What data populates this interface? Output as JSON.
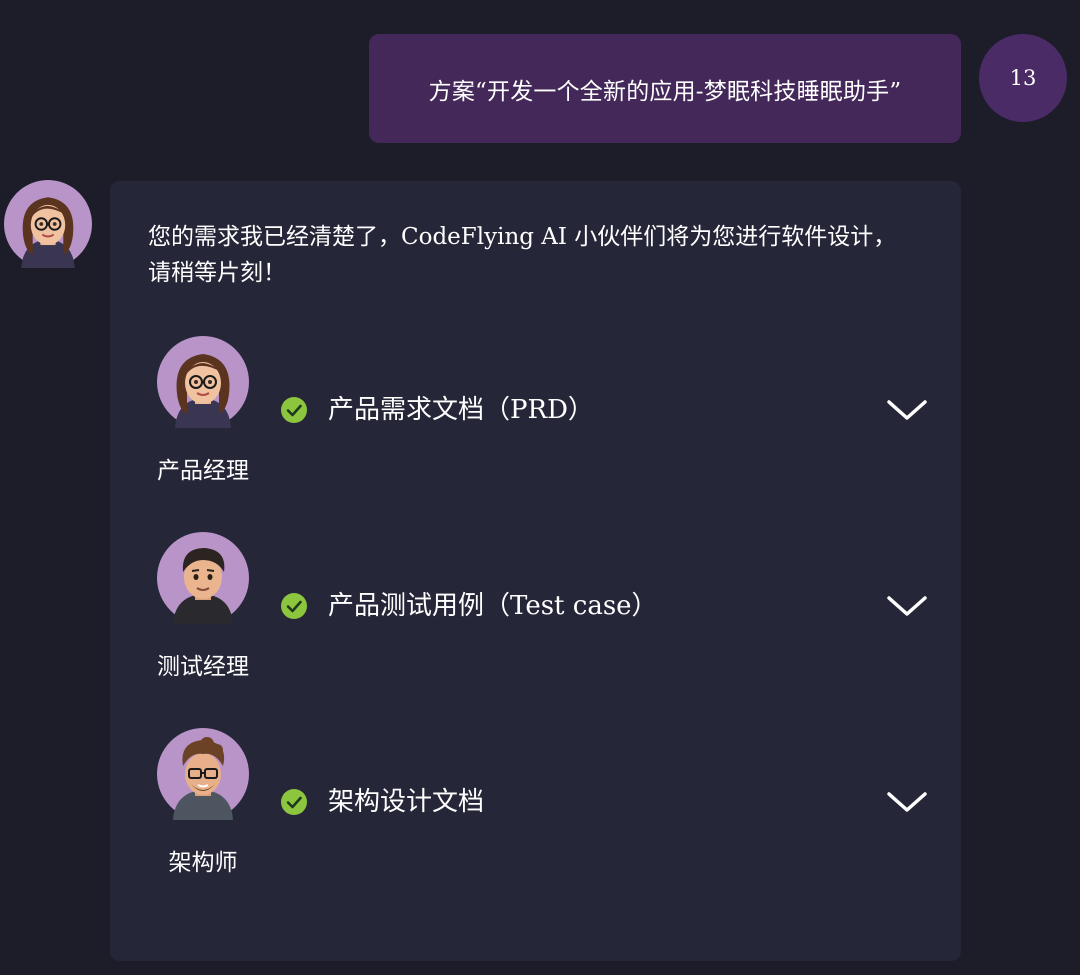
{
  "user_message": {
    "text": "方案“开发一个全新的应用-梦眠科技睡眠助手”",
    "avatar_label": "13"
  },
  "bot_message": {
    "intro": "您的需求我已经清楚了，CodeFlying AI 小伙伴们将为您进行软件设计，请稍等片刻！",
    "tasks": [
      {
        "role": "产品经理",
        "title": "产品需求文档（PRD）",
        "status": "complete"
      },
      {
        "role": "测试经理",
        "title": "产品测试用例（Test case）",
        "status": "complete"
      },
      {
        "role": "架构师",
        "title": "架构设计文档",
        "status": "complete"
      }
    ]
  },
  "colors": {
    "background": "#1c1d29",
    "user_bubble": "#432859",
    "bot_card": "#252638",
    "check_green": "#8cc63f",
    "avatar_bg": "#b994c9"
  }
}
